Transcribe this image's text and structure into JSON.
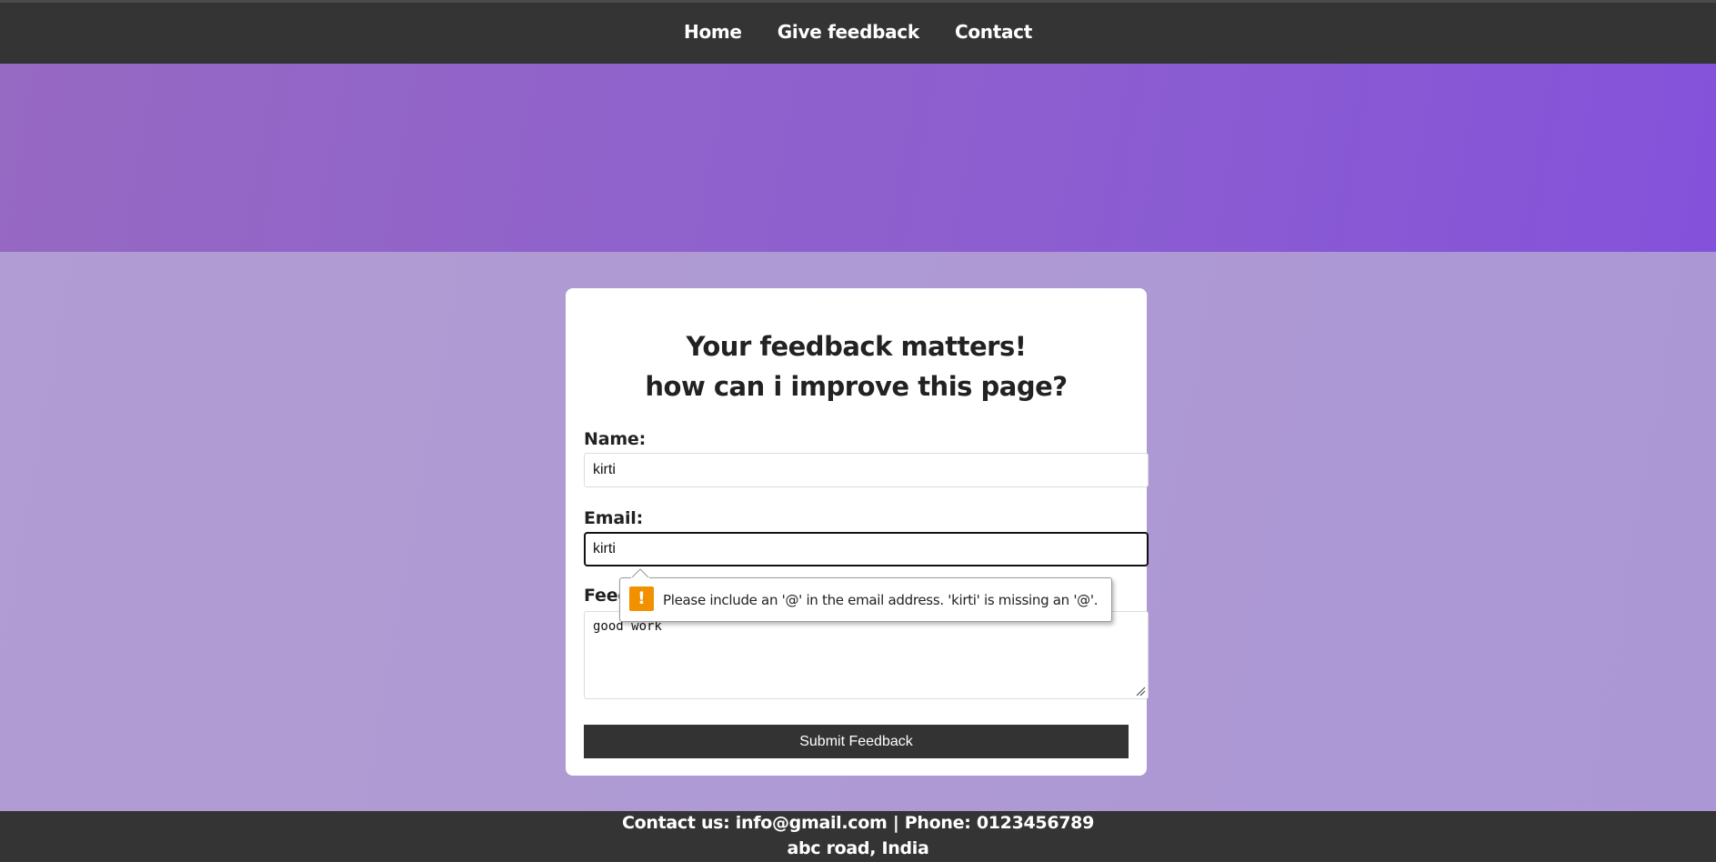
{
  "nav": {
    "items": [
      {
        "label": "Home"
      },
      {
        "label": "Give feedback"
      },
      {
        "label": "Contact"
      }
    ]
  },
  "form": {
    "heading_line1": "Your feedback matters!",
    "heading_line2": "how can i improve this page?",
    "name_label": "Name:",
    "name_value": "kirti",
    "email_label": "Email:",
    "email_value": "kirti",
    "feedback_label": "Feedback:",
    "feedback_value": "good work",
    "submit_label": "Submit Feedback"
  },
  "validation": {
    "message": "Please include an '@' in the email address. 'kirti' is missing an '@'.",
    "icon": "warning-icon",
    "icon_color": "#f29100"
  },
  "footer": {
    "line1": "Contact us: info@gmail.com | Phone: 0123456789",
    "line2": "abc road, India"
  },
  "colors": {
    "header_bg": "#343434",
    "hero_gradient_start": "#9669c3",
    "hero_gradient_end": "#8452da",
    "page_bg": "#ad99d4",
    "button_bg": "#333333"
  }
}
